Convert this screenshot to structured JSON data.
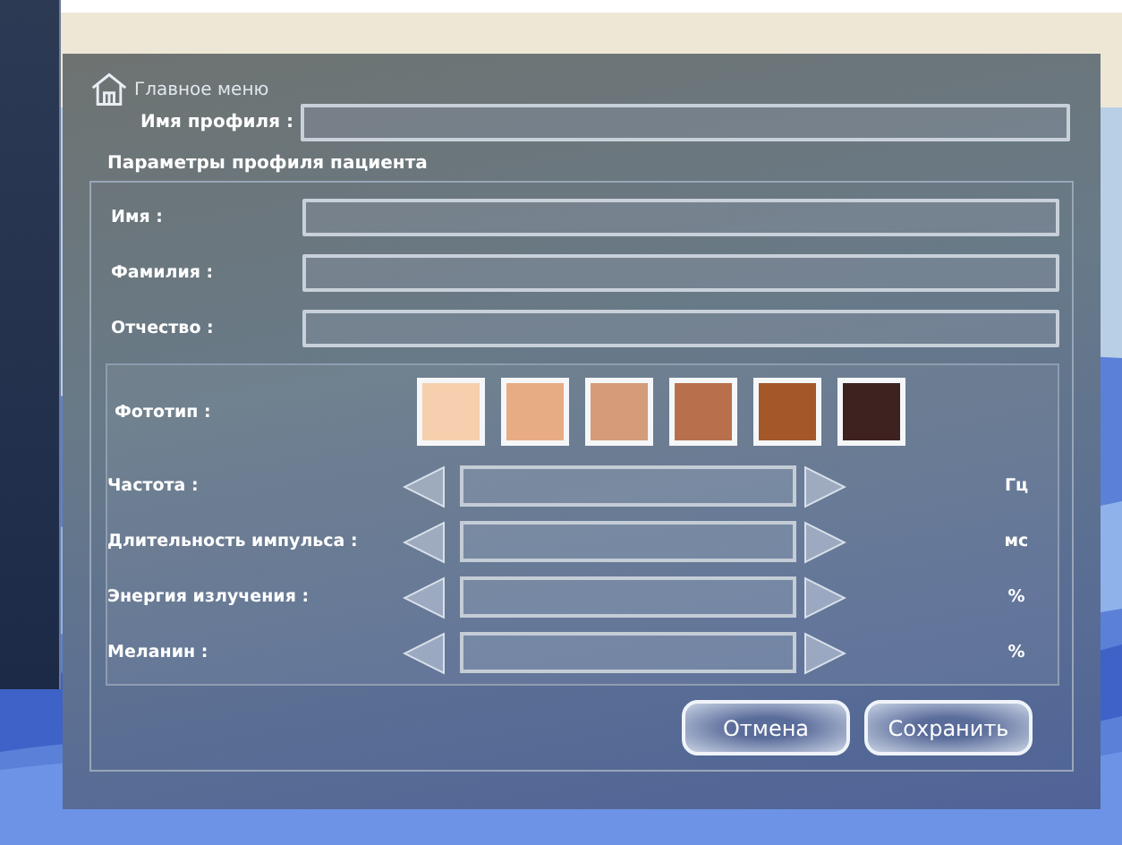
{
  "header": {
    "menu_link": "Главное меню",
    "profile_label": "Имя профиля :"
  },
  "section_title": "Параметры профиля пациента",
  "fields": [
    {
      "label": "Имя :"
    },
    {
      "label": "Фамилия :"
    },
    {
      "label": "Отчество :"
    }
  ],
  "phototype": {
    "label": "Фототип :",
    "swatches": [
      {
        "color": "#f6cfae"
      },
      {
        "color": "#e8ac84"
      },
      {
        "color": "#d49c78"
      },
      {
        "color": "#b8704c"
      },
      {
        "color": "#a4582a"
      },
      {
        "color": "#3e2220"
      }
    ]
  },
  "sliders": [
    {
      "label": "Частота :",
      "unit": "Гц"
    },
    {
      "label": "Длительность импульса :",
      "unit": "мс"
    },
    {
      "label": "Энергия излучения :",
      "unit": "%"
    },
    {
      "label": "Меланин :",
      "unit": "%"
    }
  ],
  "buttons": [
    "Отмена",
    "Сохранить"
  ]
}
